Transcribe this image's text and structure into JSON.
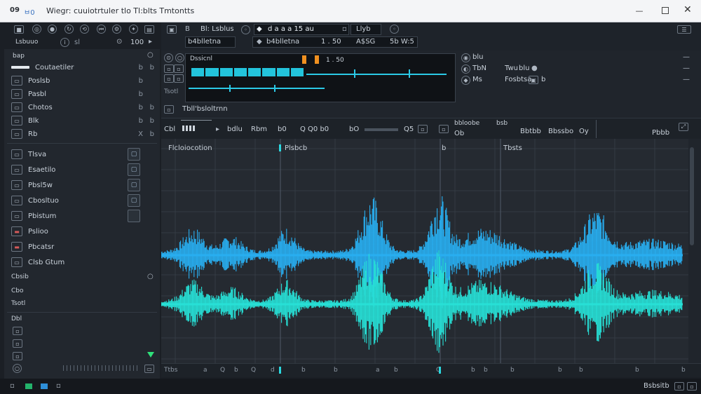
{
  "title_bar": {
    "app_badge": "09",
    "app_code": "ㅂ0",
    "title": "Wiegr: cuuiotrtuler tlo Tl:blts  Tmtontts"
  },
  "toolbar": {
    "tool_icons": [
      "stop-icon",
      "target-icon",
      "record-icon",
      "refresh-icon",
      "loop-icon",
      "rewind-icon",
      "settings-icon"
    ],
    "preset_name": "Bl: Lsblus",
    "transport_time": "d   a   a   a   15   au",
    "track_label": "Llyb",
    "display_a": "b4blletna",
    "display_b": "1 . 50",
    "display_c": "A$SG",
    "display_d": "5b  W:5",
    "display_e": "Tbuai"
  },
  "sidebar": {
    "top_left": "Lsbuuo",
    "top_mid": "sl",
    "top_right": "100",
    "header": "bap",
    "items": [
      {
        "label": "Coutaetiler",
        "r1": "b",
        "r2": "b"
      },
      {
        "label": "Poslsb",
        "r1": "b",
        "r2": ""
      },
      {
        "label": "Pasbl",
        "r1": "b",
        "r2": ""
      },
      {
        "label": "Chotos",
        "r1": "b",
        "r2": "b"
      },
      {
        "label": "Blk",
        "r1": "b",
        "r2": "b"
      },
      {
        "label": "Rb",
        "r1": "X",
        "r2": "b"
      }
    ],
    "items2": [
      {
        "label": "Tlsva"
      },
      {
        "label": "Esaetilo"
      },
      {
        "label": "Pbsl5w"
      },
      {
        "label": "Cbosltuo"
      },
      {
        "label": "Pbistum"
      },
      {
        "label": "Pslioo"
      },
      {
        "label": "Pbcatsr"
      },
      {
        "label": "Clsb Gtum"
      }
    ],
    "footer_a": "Cbsib",
    "footer_b": "Cbo",
    "footer_c": "Tsotl",
    "footer_d": "Dbl"
  },
  "mixer": {
    "channel_label": "Dssicnl",
    "track_name": "Tbll'bsloltrnn",
    "right_a": "blu",
    "right_b": "TbN",
    "right_c": "Twu",
    "right_d": "blu",
    "right_e": "Ms",
    "right_f": "Fosbtsa",
    "right_g": "b",
    "right_h": "Ths",
    "right_i": "Tos",
    "rows": [
      "b",
      "a",
      "b"
    ]
  },
  "timeline_toolbar": {
    "left": "Cbl",
    "items": [
      "bdlu",
      "Rbm",
      "b0",
      "Q Q0 b0",
      "bO",
      "Q5",
      "Ob"
    ],
    "right_a": "bbloobe",
    "right_b": "bsb",
    "right_c": "Bbtbb",
    "right_d": "Bbssbo",
    "right_e": "Oy",
    "right_f": "Pbbb"
  },
  "markers": [
    {
      "label": "Flcloiocotion"
    },
    {
      "label": "Plsbcb"
    },
    {
      "label": "b"
    },
    {
      "label": "Tbsts"
    }
  ],
  "bottom_ruler": [
    "Ttbs",
    "a",
    "Q",
    "b",
    "Q",
    "d",
    "b",
    "b",
    "a",
    "b",
    "Q",
    "b",
    "b",
    "b",
    "b",
    "b",
    "b",
    "b"
  ],
  "status_bar": {
    "right": "Bsbsitb"
  },
  "colors": {
    "wave_top": "#28aef0",
    "wave_bottom": "#27e0d6",
    "accent": "#2bc9e6",
    "orange": "#f09020"
  }
}
